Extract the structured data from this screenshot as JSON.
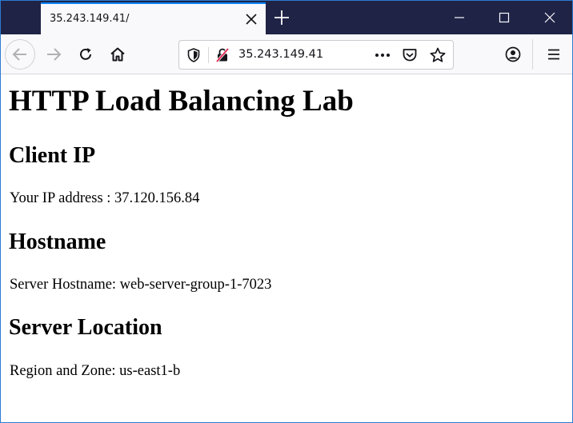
{
  "browser": {
    "tab_title": "35.243.149.41/",
    "url": "35.243.149.41",
    "icons": {
      "tab_close": "close-icon",
      "new_tab": "plus-icon",
      "minimize": "minimize-icon",
      "maximize": "maximize-icon",
      "close_window": "close-icon",
      "back": "back-arrow-icon",
      "forward": "forward-arrow-icon",
      "reload": "reload-icon",
      "home": "home-icon",
      "tracking": "shield-icon",
      "insecure": "insecure-lock-icon",
      "more": "more-dots-icon",
      "pocket": "pocket-icon",
      "bookmark": "star-icon",
      "account": "account-icon",
      "menu": "hamburger-menu-icon"
    },
    "colors": {
      "titlebar": "#1f2346",
      "toolbar": "#f9f9fb",
      "tab_accent": "#0a84ff",
      "insecure_accent": "#e22850"
    }
  },
  "page": {
    "heading": "HTTP Load Balancing Lab",
    "client_ip": {
      "title": "Client IP",
      "text": "Your IP address : 37.120.156.84"
    },
    "hostname": {
      "title": "Hostname",
      "text": "Server Hostname: web-server-group-1-7023"
    },
    "location": {
      "title": "Server Location",
      "text": "Region and Zone: us-east1-b"
    }
  }
}
